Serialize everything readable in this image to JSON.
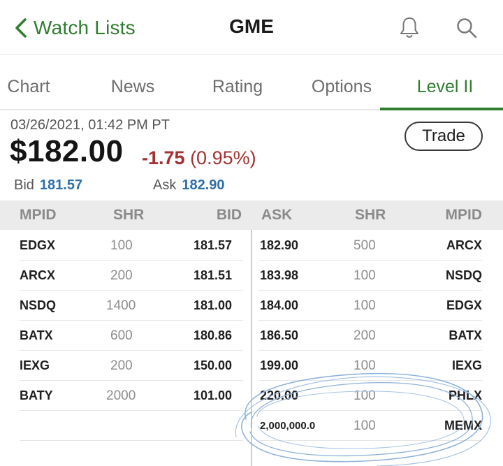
{
  "header": {
    "back_label": "Watch Lists",
    "title": "GME"
  },
  "icons": {
    "back": "chevron-left-icon",
    "bell": "bell-icon",
    "search": "search-icon"
  },
  "tabs": [
    {
      "label": "Chart",
      "active": false
    },
    {
      "label": "News",
      "active": false
    },
    {
      "label": "Rating",
      "active": false
    },
    {
      "label": "Options",
      "active": false
    },
    {
      "label": "Level II",
      "active": true
    }
  ],
  "quote": {
    "timestamp": "03/26/2021, 01:42 PM PT",
    "price": "$182.00",
    "change": "-1.75",
    "change_pct": "(0.95%)",
    "bid_label": "Bid",
    "bid": "181.57",
    "ask_label": "Ask",
    "ask": "182.90",
    "trade_label": "Trade"
  },
  "table": {
    "headers": [
      "MPID",
      "SHR",
      "BID",
      "ASK",
      "SHR",
      "MPID"
    ],
    "rows": [
      {
        "bid_mpid": "EDGX",
        "bid_shr": "100",
        "bid": "181.57",
        "ask": "182.90",
        "ask_shr": "500",
        "ask_mpid": "ARCX"
      },
      {
        "bid_mpid": "ARCX",
        "bid_shr": "200",
        "bid": "181.51",
        "ask": "183.98",
        "ask_shr": "100",
        "ask_mpid": "NSDQ"
      },
      {
        "bid_mpid": "NSDQ",
        "bid_shr": "1400",
        "bid": "181.00",
        "ask": "184.00",
        "ask_shr": "100",
        "ask_mpid": "EDGX"
      },
      {
        "bid_mpid": "BATX",
        "bid_shr": "600",
        "bid": "180.86",
        "ask": "186.50",
        "ask_shr": "200",
        "ask_mpid": "BATX"
      },
      {
        "bid_mpid": "IEXG",
        "bid_shr": "200",
        "bid": "150.00",
        "ask": "199.00",
        "ask_shr": "100",
        "ask_mpid": "IEXG"
      },
      {
        "bid_mpid": "BATY",
        "bid_shr": "2000",
        "bid": "101.00",
        "ask": "220.00",
        "ask_shr": "100",
        "ask_mpid": "PHLX"
      },
      {
        "bid_mpid": "",
        "bid_shr": "",
        "bid": "",
        "ask": "2,000,000.0",
        "ask_shr": "100",
        "ask_mpid": "MEMX"
      }
    ]
  },
  "colors": {
    "accent_green": "#2f7d2f",
    "negative_red": "#a63030",
    "value_blue": "#2d6fa6",
    "scribble_blue": "#8fb2d9"
  }
}
